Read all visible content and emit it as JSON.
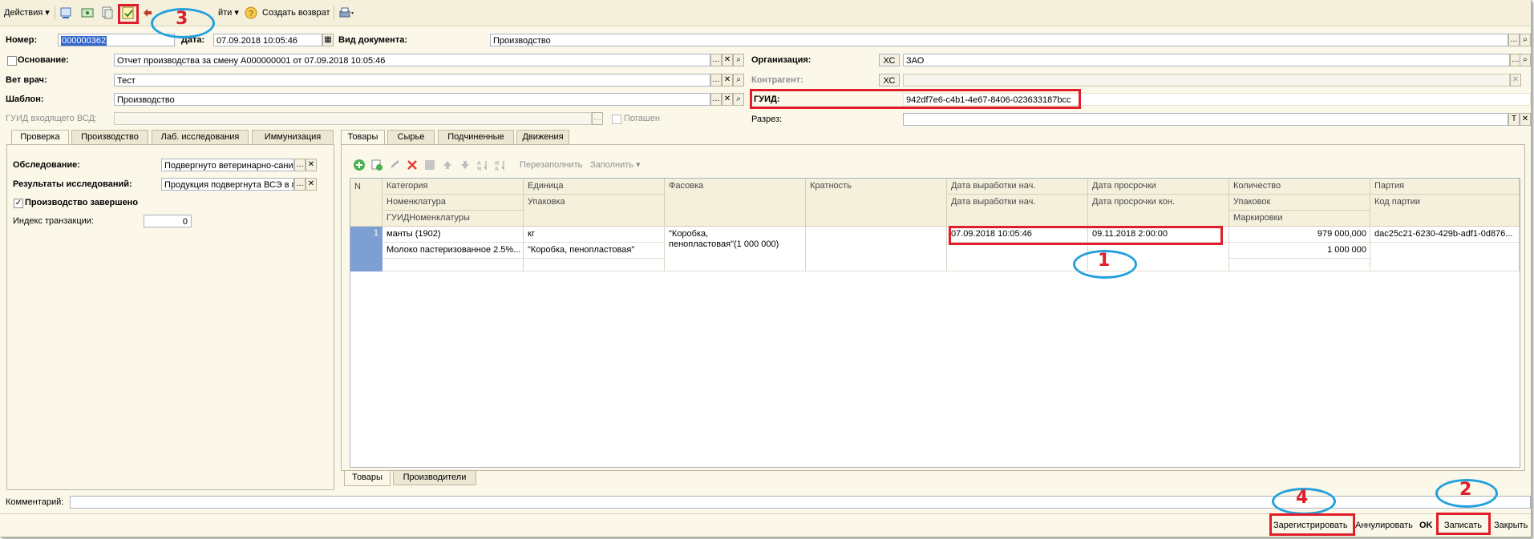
{
  "toolbar": {
    "actions_label": "Действия ▾",
    "goto_label": "йти ▾",
    "return_label": "Создать возврат"
  },
  "header": {
    "number_label": "Номер:",
    "number_value": "000000362",
    "date_label": "Дата:",
    "date_value": "07.09.2018 10:05:46",
    "doctype_label": "Вид документа:",
    "doctype_value": "Производство",
    "basis_label": "Основание:",
    "basis_value": "Отчет производства за смену А000000001 от 07.09.2018 10:05:46",
    "vet_label": "Вет врач:",
    "vet_value": "Тест",
    "template_label": "Шаблон:",
    "template_value": "Производство",
    "guid_in_label": "ГУИД входящего ВСД:",
    "repaid_label": "Погашен",
    "org_label": "Организация:",
    "org_code": "ХС",
    "org_value": "ЗАО",
    "contractor_label": "Контрагент:",
    "contractor_code": "ХС",
    "guid_label": "ГУИД:",
    "guid_value": "942df7e6-c4b1-4e67-8406-023633187bcc",
    "section_label": "Разрез:"
  },
  "left_tabs": [
    "Проверка",
    "Производство",
    "Лаб. исследования",
    "Иммунизация"
  ],
  "left_panel": {
    "exam_label": "Обследование:",
    "exam_value": "Подвергнуто ветеринарно-сани",
    "results_label": "Результаты исследований:",
    "results_value": "Продукция подвергнута ВСЭ в г",
    "done_label": "Производство завершено",
    "index_label": "Индекс транзакции:",
    "index_value": "0"
  },
  "right_tabs": [
    "Товары",
    "Сырье",
    "Подчиненные",
    "Движения"
  ],
  "grid_toolbar": {
    "refill_label": "Перезаполнить",
    "fill_label": "Заполнить ▾"
  },
  "grid": {
    "headers_row1": [
      "N",
      "Категория",
      "Единица",
      "Фасовка",
      "Кратность",
      "Дата выработки нач.",
      "Дата просрочки",
      "Количество",
      "Партия"
    ],
    "headers_row2": [
      "Номенклатура",
      "Упаковка",
      "Дата выработки нач.",
      "Дата просрочки кон.",
      "Упаковок",
      "Код партии"
    ],
    "headers_row3": [
      "ГУИДНоменклатуры",
      "Маркировки"
    ],
    "row": {
      "n": "1",
      "category": "манты (1902)",
      "unit": "кг",
      "packing_line1": "\"Коробка,",
      "packing_line2": "пенопластовая\"(1 000 000)",
      "date_start": "07.09.2018 10:05:46",
      "date_expire": "09.11.2018 2:00:00",
      "quantity": "979 000,000",
      "batch": "dac25c21-6230-429b-adf1-0d876...",
      "nomenclature": "Молоко пастеризованное 2.5%...",
      "package": "\"Коробка, пенопластовая\"",
      "packages": "1 000 000"
    }
  },
  "bottom_tabs": [
    "Товары",
    "Производители"
  ],
  "comment_label": "Комментарий:",
  "buttons": {
    "register": "Зарегистрировать",
    "cancel": "Аннулировать",
    "ok": "OK",
    "write": "Записать",
    "close": "Закрыть"
  },
  "annotations": [
    "1",
    "2",
    "3",
    "4"
  ],
  "colors": {
    "annotation_red": "#e01d2a",
    "annotation_blue": "#23a0dd",
    "selection": "#7d9fd3"
  }
}
